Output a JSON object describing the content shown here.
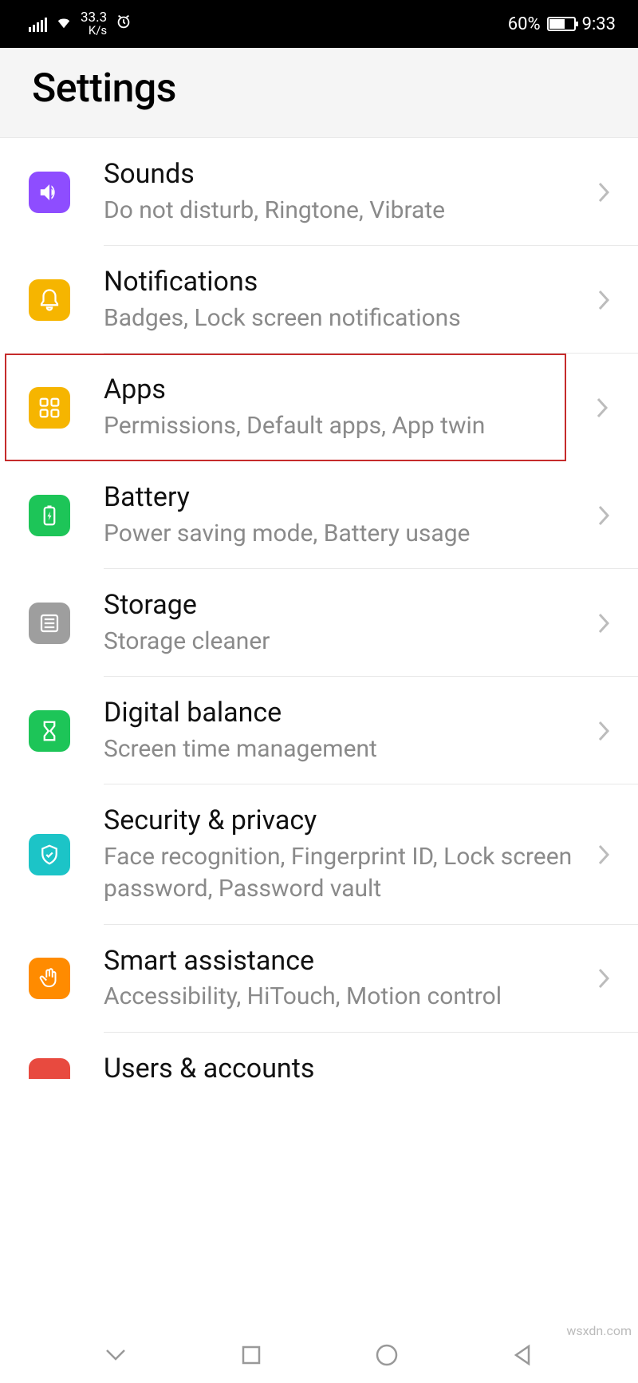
{
  "status": {
    "speed": "33.3",
    "speed_unit": "K/s",
    "battery_pct": "60%",
    "time": "9:33"
  },
  "header": {
    "title": "Settings"
  },
  "items": [
    {
      "id": "sounds",
      "title": "Sounds",
      "subtitle": "Do not disturb, Ringtone, Vibrate",
      "color": "purple",
      "highlighted": false
    },
    {
      "id": "notifications",
      "title": "Notifications",
      "subtitle": "Badges, Lock screen notifications",
      "color": "yellow",
      "highlighted": false
    },
    {
      "id": "apps",
      "title": "Apps",
      "subtitle": "Permissions, Default apps, App twin",
      "color": "yellow",
      "highlighted": true
    },
    {
      "id": "battery",
      "title": "Battery",
      "subtitle": "Power saving mode, Battery usage",
      "color": "green",
      "highlighted": false
    },
    {
      "id": "storage",
      "title": "Storage",
      "subtitle": "Storage cleaner",
      "color": "gray",
      "highlighted": false
    },
    {
      "id": "digital-balance",
      "title": "Digital balance",
      "subtitle": "Screen time management",
      "color": "green",
      "highlighted": false
    },
    {
      "id": "security-privacy",
      "title": "Security & privacy",
      "subtitle": "Face recognition, Fingerprint ID, Lock screen password, Password vault",
      "color": "teal",
      "highlighted": false
    },
    {
      "id": "smart-assistance",
      "title": "Smart assistance",
      "subtitle": "Accessibility, HiTouch, Motion control",
      "color": "orange",
      "highlighted": false
    },
    {
      "id": "users-accounts",
      "title": "Users & accounts",
      "subtitle": "",
      "color": "red",
      "highlighted": false,
      "partial": true
    }
  ],
  "watermark": "wsxdn.com"
}
